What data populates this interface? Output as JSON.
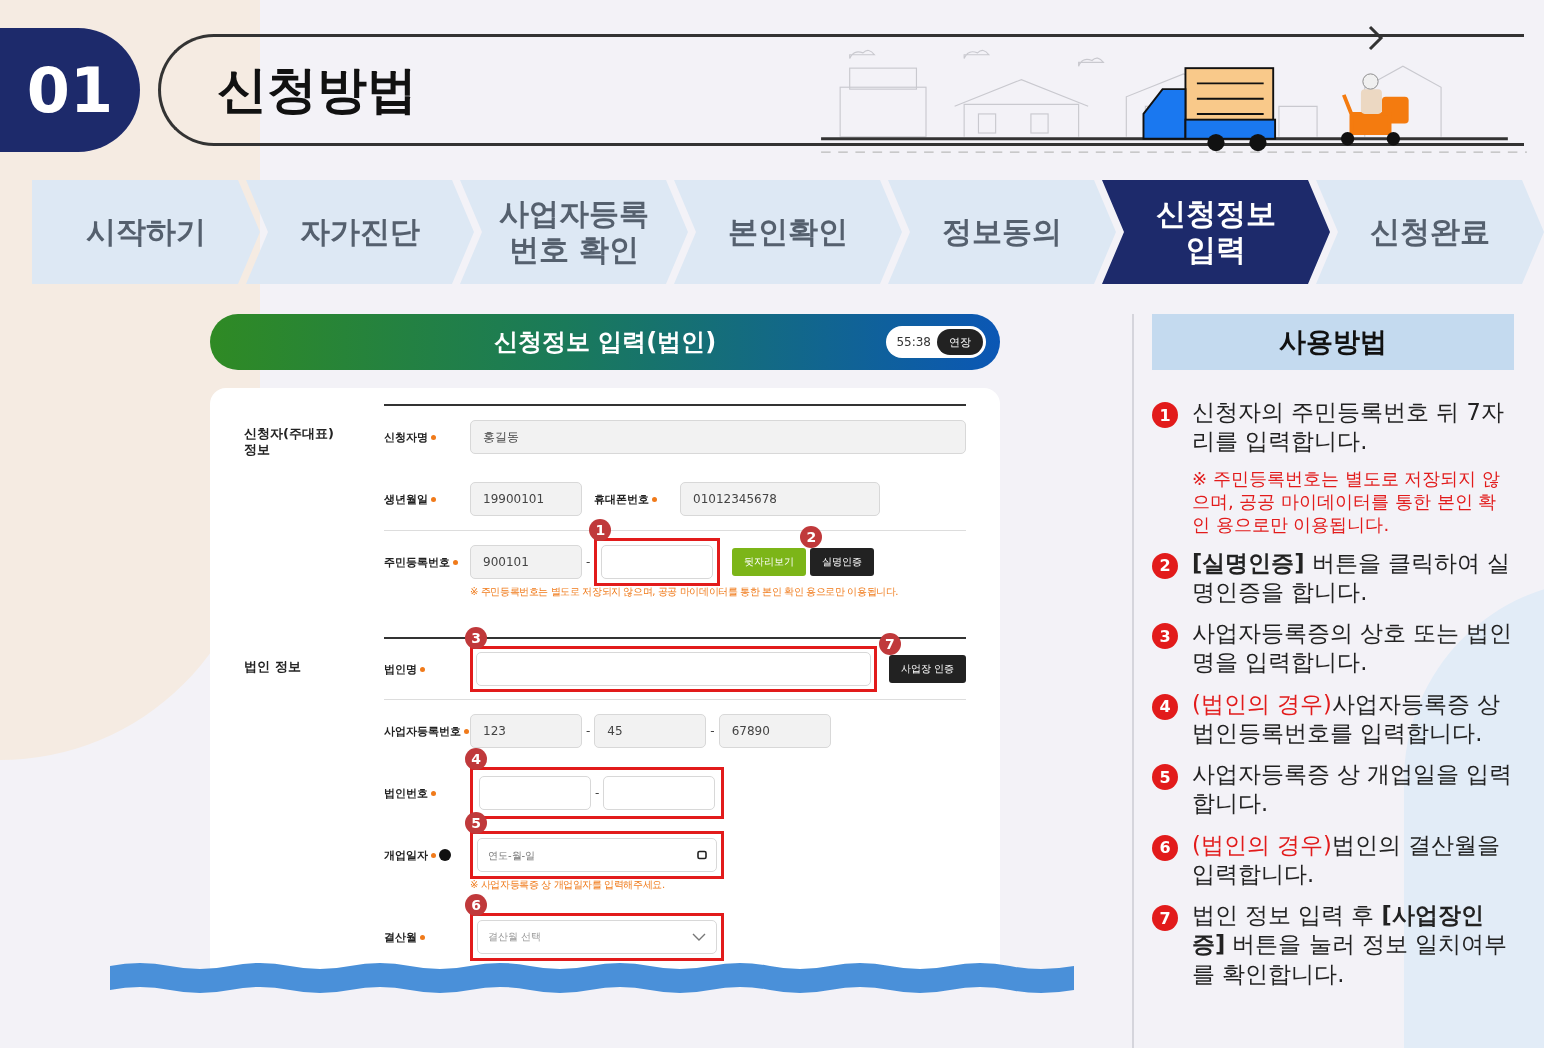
{
  "header": {
    "number": "01",
    "title": "신청방법"
  },
  "steps": [
    {
      "label": "시작하기",
      "selected": false
    },
    {
      "label": "자가진단",
      "selected": false
    },
    {
      "label": "사업자등록 번호 확인",
      "selected": false
    },
    {
      "label": "본인확인",
      "selected": false
    },
    {
      "label": "정보동의",
      "selected": false
    },
    {
      "label": "신청정보 입력",
      "selected": true
    },
    {
      "label": "신청완료",
      "selected": false
    }
  ],
  "form": {
    "title": "신청정보 입력(법인)",
    "timer": "55:38",
    "extend_button": "연장",
    "sections": [
      {
        "title": "신청자(주대표) 정보",
        "rows": [
          {
            "cells": [
              {
                "label": "신청자명",
                "required": true,
                "wide": true,
                "inputs": [
                  {
                    "kind": "text",
                    "value": "홍길동"
                  }
                ]
              }
            ]
          },
          {
            "divider": true,
            "cells": [
              {
                "label": "생년월일",
                "required": true,
                "inputs": [
                  {
                    "kind": "text",
                    "value": "19900101"
                  }
                ]
              },
              {
                "label": "휴대폰번호",
                "required": true,
                "inputs": [
                  {
                    "kind": "text",
                    "value": "01012345678"
                  }
                ]
              }
            ]
          },
          {
            "cells": [
              {
                "label": "주민등록번호",
                "required": true,
                "separator": "-",
                "inputs": [
                  {
                    "kind": "text",
                    "value": "900101"
                  },
                  {
                    "kind": "text",
                    "marker": "1"
                  }
                ],
                "buttons": [
                  {
                    "label": "뒷자리보기",
                    "kind": "green"
                  },
                  {
                    "label": "실명인증",
                    "kind": "dark",
                    "marker": "2"
                  }
                ],
                "note": "※ 주민등록번호는 별도로 저장되지 않으며, 공공 마이데이터를 통한 본인 확인 용으로만 이용됩니다."
              }
            ]
          }
        ]
      },
      {
        "title": "법인 정보",
        "rows": [
          {
            "divider": true,
            "cells": [
              {
                "label": "법인명",
                "required": true,
                "wide": true,
                "inputs": [
                  {
                    "kind": "text",
                    "marker": "3"
                  }
                ],
                "buttons": [
                  {
                    "label": "사업장 인증",
                    "kind": "dark",
                    "marker": "7"
                  }
                ]
              }
            ]
          },
          {
            "cells": [
              {
                "label": "사업자등록번호",
                "required": true,
                "separator": "-",
                "inputs": [
                  {
                    "kind": "text",
                    "value": "123"
                  },
                  {
                    "kind": "text",
                    "value": "45"
                  },
                  {
                    "kind": "text",
                    "value": "67890"
                  }
                ]
              }
            ]
          },
          {
            "cells": [
              {
                "label": "법인번호",
                "required": true,
                "separator": "-",
                "marker": "4",
                "inputs": [
                  {
                    "kind": "text"
                  },
                  {
                    "kind": "text"
                  }
                ]
              }
            ]
          },
          {
            "cells": [
              {
                "label": "개업일자",
                "required": true,
                "info": true,
                "inputs": [
                  {
                    "kind": "date",
                    "placeholder": "연도-월-일",
                    "marker": "5"
                  }
                ],
                "note": "※ 사업자등록증 상 개업일자를 입력해주세요."
              }
            ]
          },
          {
            "cells": [
              {
                "label": "결산월",
                "required": true,
                "inputs": [
                  {
                    "kind": "select",
                    "placeholder": "결산월 선택",
                    "marker": "6"
                  }
                ]
              }
            ]
          }
        ]
      }
    ]
  },
  "guide": {
    "title": "사용방법",
    "items": [
      {
        "number": "1",
        "text": "신청자의 주민등록번호 뒤 7자리를 입력합니다.",
        "note": "※ 주민등록번호는 별도로 저장되지 않으며, 공공 마이데이터를 통한 본인 확인 용으로만 이용됩니다."
      },
      {
        "number": "2",
        "text": "**[실명인증]** 버튼을 클릭하여 실명인증을 합니다."
      },
      {
        "number": "3",
        "text": "사업자등록증의 상호 또는 법인명을 입력합니다."
      },
      {
        "number": "4",
        "highlight": "(법인의 경우)",
        "text": "사업자등록증 상 법인등록번호를 입력합니다."
      },
      {
        "number": "5",
        "text": "사업자등록증 상 개업일을 입력합니다."
      },
      {
        "number": "6",
        "highlight": "(법인의 경우)",
        "text": "법인의 결산월을 입력합니다."
      },
      {
        "number": "7",
        "text": "법인 정보 입력 후 **[사업장인증]** 버튼을 눌러 정보 일치여부를 확인합니다."
      }
    ]
  }
}
